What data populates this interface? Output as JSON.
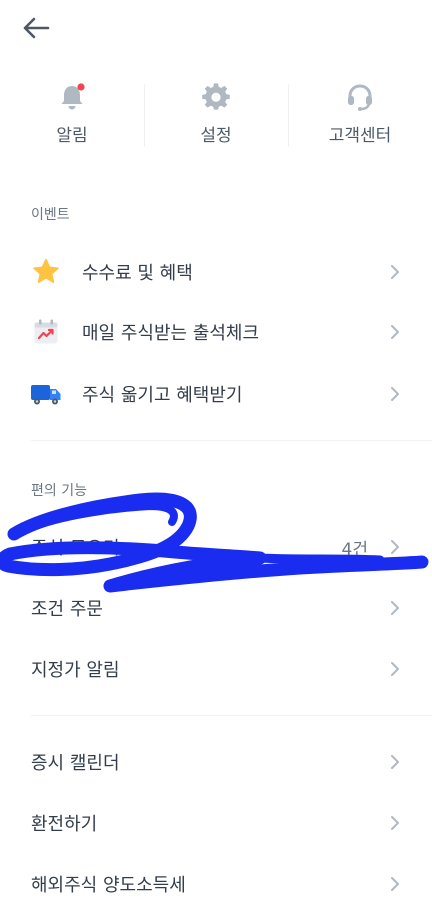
{
  "quick": [
    {
      "label": "알림",
      "icon": "bell-icon"
    },
    {
      "label": "설정",
      "icon": "gear-icon"
    },
    {
      "label": "고객센터",
      "icon": "headset-icon"
    }
  ],
  "events": {
    "title": "이벤트",
    "items": [
      {
        "label": "수수료 및 혜택",
        "icon": "star-icon"
      },
      {
        "label": "매일 주식받는 출석체크",
        "icon": "calendar-chart-icon"
      },
      {
        "label": "주식 옮기고 혜택받기",
        "icon": "truck-icon"
      }
    ]
  },
  "features": {
    "title": "편의 기능",
    "items": [
      {
        "label": "주식 모으기",
        "count": "4건"
      },
      {
        "label": "조건 주문"
      },
      {
        "label": "지정가 알림"
      }
    ]
  },
  "more": {
    "items": [
      {
        "label": "증시 캘린더"
      },
      {
        "label": "환전하기"
      },
      {
        "label": "해외주식 양도소득세"
      }
    ]
  },
  "colors": {
    "accent_red": "#f04452",
    "scribble_blue": "#1a2cf0",
    "icon_gray": "#b0b8c1"
  }
}
